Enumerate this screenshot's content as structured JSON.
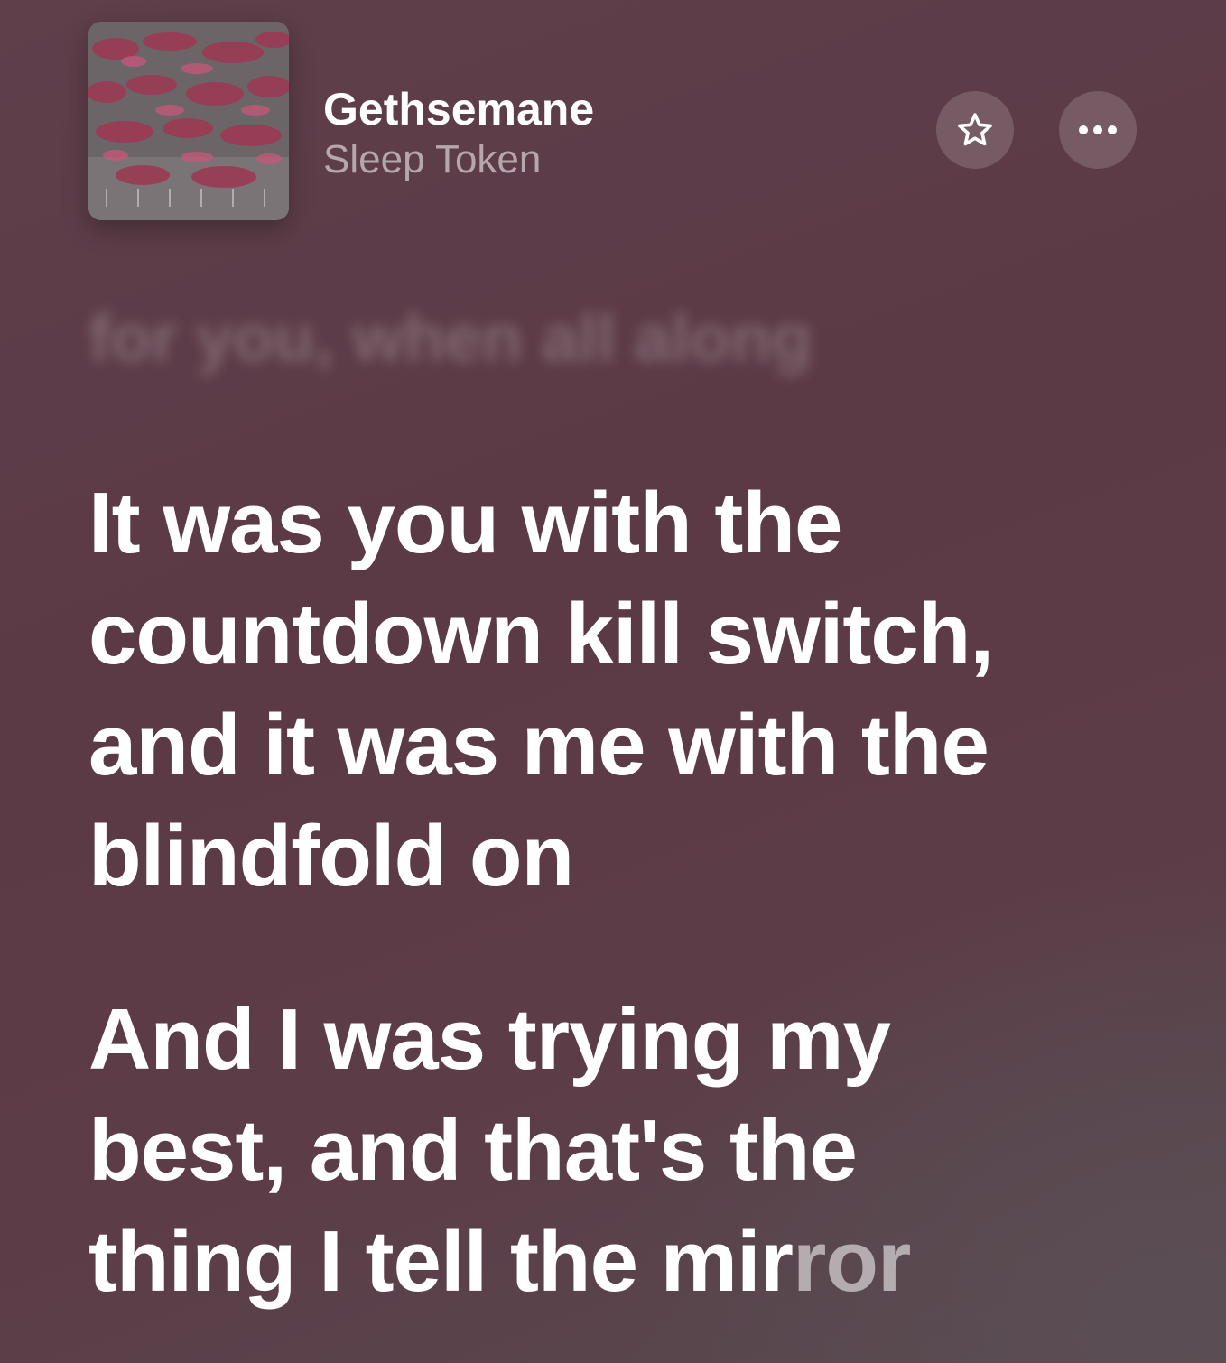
{
  "now_playing": {
    "title": "Gethsemane",
    "artist": "Sleep Token",
    "artwork_icon": "album-artwork",
    "favorite_icon": "star-icon",
    "more_icon": "ellipsis-icon"
  },
  "lyrics": {
    "previous_line": "for you, when all along",
    "current": [
      "It was you with the",
      "countdown kill switch,",
      "and it was me with the",
      "blindfold on"
    ],
    "next_lines": [
      "And I was trying my",
      "best, and that's the"
    ],
    "next_last_sung": "thing I tell the mir",
    "next_last_unsung": "ror"
  },
  "colors": {
    "background": "#5c3c47",
    "text": "#ffffff"
  }
}
